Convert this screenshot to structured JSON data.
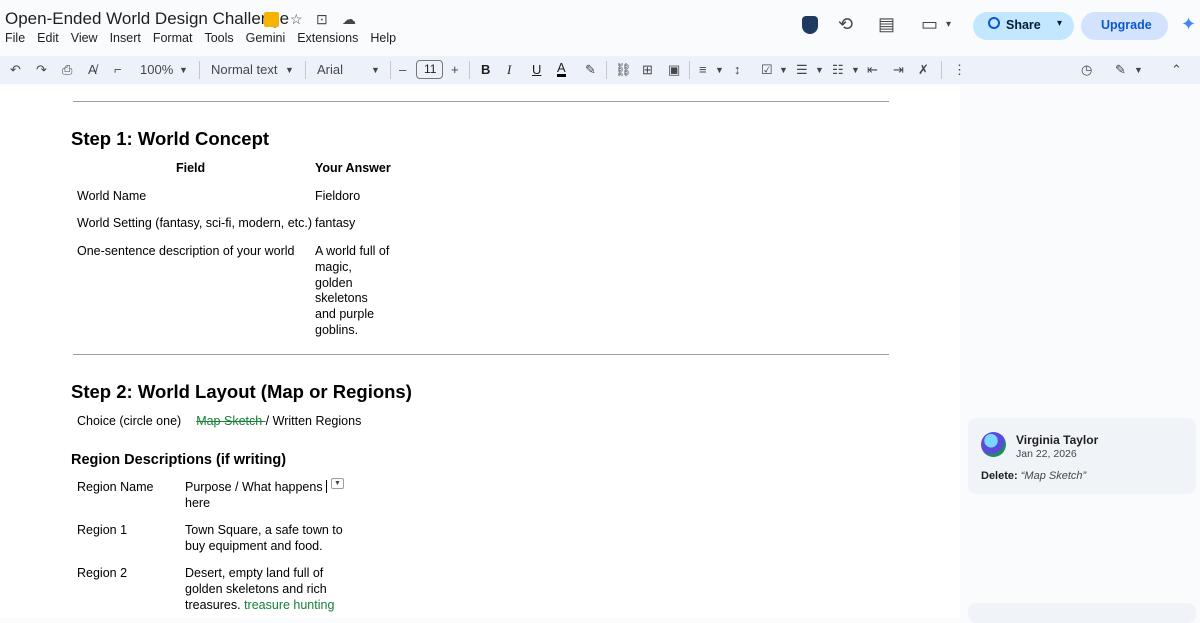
{
  "title_bar": {
    "doc_title": "Open-Ended World Design Challenge",
    "menus": [
      "File",
      "Edit",
      "View",
      "Insert",
      "Format",
      "Tools",
      "Gemini",
      "Extensions",
      "Help"
    ],
    "share_label": "Share",
    "upgrade_label": "Upgrade"
  },
  "toolbar": {
    "zoom": "100%",
    "style": "Normal text",
    "font": "Arial",
    "font_size": "11",
    "minus": "–",
    "plus": "+",
    "bold": "B",
    "italic": "I",
    "underline": "U",
    "text_color": "A"
  },
  "doc": {
    "step1_heading": "Step 1: World Concept",
    "table1": {
      "headers": [
        "Field",
        "Your Answer"
      ],
      "rows": [
        {
          "field": "World Name",
          "answer": "Fieldoro"
        },
        {
          "field": "World Setting (fantasy, sci-fi, modern, etc.)",
          "answer": "fantasy"
        },
        {
          "field": "One-sentence description of your world",
          "answer": [
            "A world full of",
            "magic,",
            "golden",
            "skeletons",
            "and purple",
            "goblins."
          ]
        }
      ]
    },
    "step2_heading": "Step 2: World Layout (Map or Regions)",
    "choice_label": "Choice (circle one)",
    "choice_struck": "Map Sketch ",
    "choice_rest": "/ Written Regions",
    "region_heading": "Region Descriptions (if writing)",
    "table2": {
      "headers": [
        "Region Name",
        [
          "Purpose / What happens",
          "here"
        ]
      ],
      "rows": [
        {
          "name": "Region 1",
          "desc": [
            "Town Square, a safe town to",
            "buy equipment and food."
          ]
        },
        {
          "name": "Region 2",
          "desc": [
            "Desert, empty land full of",
            "golden skeletons and rich",
            "treasures."
          ],
          "suggestion": "treasure hunting"
        }
      ]
    }
  },
  "comment": {
    "author": "Virginia Taylor",
    "date": "Jan 22, 2026",
    "action": "Delete:",
    "quote": "“Map Sketch”"
  },
  "colors": {
    "suggestion_green": "#188038",
    "share_bg": "#c2e7ff",
    "toolbar_bg": "#edf2fa"
  }
}
